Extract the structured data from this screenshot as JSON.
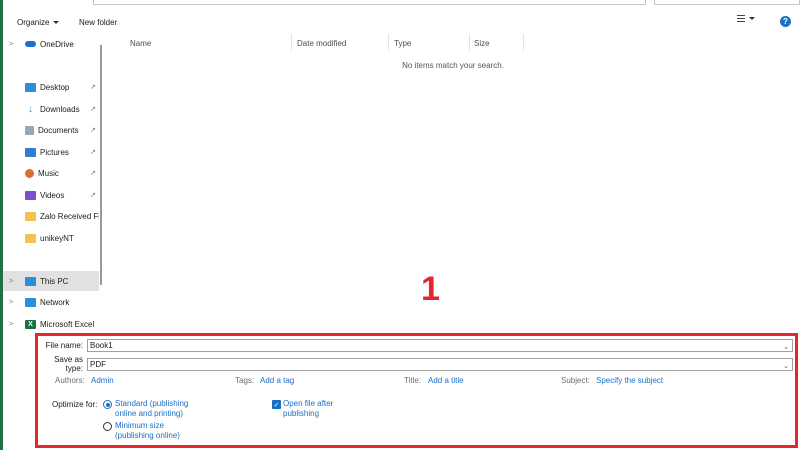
{
  "toolbar": {
    "organize_label": "Organize",
    "new_folder_label": "New folder"
  },
  "nav": {
    "items": [
      {
        "label": "OneDrive",
        "icon": "cloud-icon",
        "color": "#1a73c9"
      },
      {
        "label": "Desktop",
        "icon": "desktop-icon",
        "color": "#2b8fd8"
      },
      {
        "label": "Downloads",
        "icon": "download-icon",
        "color": "#2b8fd8"
      },
      {
        "label": "Documents",
        "icon": "documents-icon",
        "color": "#8a8a8a"
      },
      {
        "label": "Pictures",
        "icon": "pictures-icon",
        "color": "#2f7fd0"
      },
      {
        "label": "Music",
        "icon": "music-icon",
        "color": "#e06b2b"
      },
      {
        "label": "Videos",
        "icon": "videos-icon",
        "color": "#7b4fd0"
      },
      {
        "label": "Zalo Received Fi",
        "icon": "folder-icon",
        "color": "#f2c34e"
      },
      {
        "label": "unikeyNT",
        "icon": "folder-icon",
        "color": "#f2c34e"
      },
      {
        "label": "This PC",
        "icon": "computer-icon",
        "color": "#2b8fd8"
      },
      {
        "label": "Network",
        "icon": "network-icon",
        "color": "#2b8fd8"
      },
      {
        "label": "Microsoft Excel",
        "icon": "excel-icon",
        "color": "#1e7145"
      }
    ]
  },
  "list": {
    "columns": [
      "Name",
      "Date modified",
      "Type",
      "Size"
    ],
    "empty_message": "No items match your search."
  },
  "overlay": {
    "number": "1",
    "color": "#e3272d"
  },
  "save": {
    "file_name_label": "File name:",
    "file_name_value": "Book1",
    "save_type_label": "Save as type:",
    "save_type_value": "PDF",
    "authors_label": "Authors:",
    "authors_value": "Admin",
    "tags_label": "Tags:",
    "tags_value": "Add a tag",
    "title_label": "Title:",
    "title_value": "Add a title",
    "subject_label": "Subject:",
    "subject_value": "Specify the subject",
    "optimize_label": "Optimize for:",
    "opt_standard_line1": "Standard (publishing",
    "opt_standard_line2": "online and printing)",
    "opt_minimum_line1": "Minimum size",
    "opt_minimum_line2": "(publishing online)",
    "open_after_line1": "Open file after",
    "open_after_line2": "publishing"
  }
}
